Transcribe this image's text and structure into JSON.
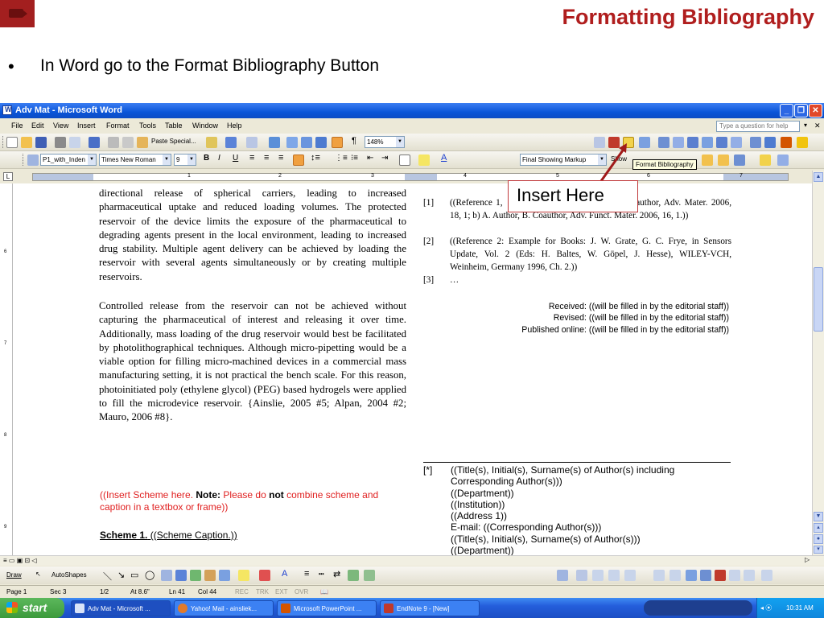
{
  "slide": {
    "title": "Formatting Bibliography",
    "bullet": "In Word go to the Format Bibliography Button",
    "callout": "Insert Here"
  },
  "window": {
    "title": "Adv Mat - Microsoft Word",
    "menu": [
      "File",
      "Edit",
      "View",
      "Insert",
      "Format",
      "Tools",
      "Table",
      "Window",
      "Help"
    ],
    "question_placeholder": "Type a question for help"
  },
  "toolbar": {
    "paste_special": "Paste Special...",
    "zoom": "148%",
    "style": "P1_with_Inden",
    "font": "Times New Roman",
    "size": "9",
    "markup": "Final Showing Markup",
    "show": "Show",
    "tooltip": "Format Bibliography"
  },
  "ruler": {
    "numbers": [
      "1",
      "2",
      "3",
      "4",
      "5",
      "6",
      "7"
    ],
    "vnumbers": [
      "6",
      "7",
      "8",
      "9"
    ]
  },
  "document": {
    "para1": "directional release of spherical carriers, leading to increased pharmaceutical uptake and reduced loading volumes. The protected reservoir of the device limits the exposure of the pharmaceutical to degrading agents present in the local environment, leading to increased drug stability. Multiple agent delivery can be achieved by loading the reservoir with several agents simultaneously or by creating multiple reservoirs.",
    "para2": "Controlled release from the reservoir can not be achieved without capturing the pharmaceutical of interest and releasing it over time. Additionally, mass loading of the drug reservoir would best be facilitated by photolithographical techniques. Although micro-pipetting would be a viable option for filling micro-machined devices in a commercial mass manufacturing setting, it is not practical the bench scale. For this reason, photoinitiated poly (ethylene glycol) (PEG) based hydrogels were applied to fill the microdevice reservoir. {Ainslie, 2005 #5; Alpan, 2004 #2; Mauro, 2006 #8}.",
    "scheme_note_a": "((Insert Scheme here. ",
    "scheme_note_b": "Note:",
    "scheme_note_c": " Please do ",
    "scheme_note_d": "not",
    "scheme_note_e": " combine scheme and caption in a textbox or frame))",
    "scheme_label": "Scheme 1.",
    "scheme_caption": " ((Scheme Caption.))",
    "refs": [
      {
        "n": "[1]",
        "t1": "((Reference 1, ",
        "t2": "hor, B. Coauthor, Adv. Mater. 2006, 18, 1; b) A. Author, B. Coauthor, Adv. Funct. Mater. 2006, 16, 1.))"
      },
      {
        "n": "[2]",
        "t": "((Reference 2: Example for Books: J. W. Grate, G. C. Frye, in Sensors Update, Vol. 2 (Eds: H. Baltes, W. Göpel, J. Hesse), WILEY-VCH, Weinheim, Germany 1996, Ch. 2.))"
      },
      {
        "n": "[3]",
        "t": "…"
      }
    ],
    "received": "Received: ((will be filled in by the editorial staff))",
    "revised": "Revised: ((will be filled in by the editorial staff))",
    "published": "Published online: ((will be filled in by the editorial staff))",
    "footnote_mark": "[*]",
    "footnote_lines": [
      "((Title(s), Initial(s), Surname(s) of Author(s) including",
      "Corresponding Author(s)))",
      "((Department))",
      "((Institution))",
      "((Address 1))",
      "E-mail: ((Corresponding Author(s)))",
      "((Title(s), Initial(s), Surname(s) of Author(s)))",
      "((Department))"
    ]
  },
  "drawbar": {
    "draw": "Draw",
    "autoshapes": "AutoShapes"
  },
  "status": {
    "page": "Page 1",
    "sec": "Sec 3",
    "pages": "1/2",
    "at": "At 8.6\"",
    "ln": "Ln 41",
    "col": "Col 44",
    "rec": "REC",
    "trk": "TRK",
    "ext": "EXT",
    "ovr": "OVR"
  },
  "taskbar": {
    "start": "start",
    "tasks": [
      "Adv Mat - Microsoft ...",
      "Yahoo! Mail - ainsliek...",
      "Microsoft PowerPoint ...",
      "EndNote 9 - [New]"
    ],
    "clock": "10:31 AM"
  }
}
